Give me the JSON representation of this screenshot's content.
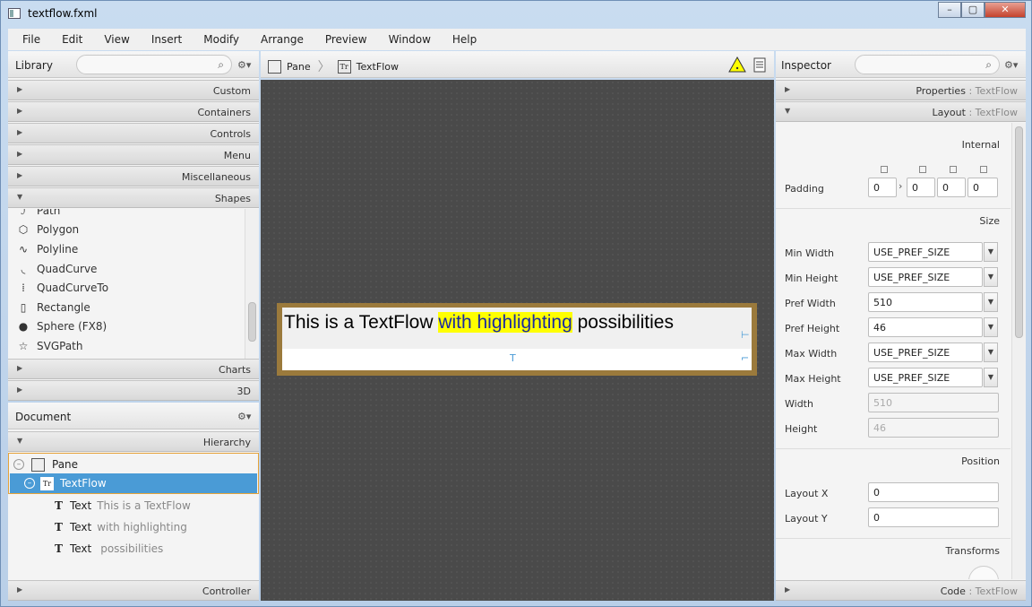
{
  "window": {
    "title": "textflow.fxml"
  },
  "menu": [
    "File",
    "Edit",
    "View",
    "Insert",
    "Modify",
    "Arrange",
    "Preview",
    "Window",
    "Help"
  ],
  "library": {
    "title": "Library",
    "sections_top": [
      "Custom",
      "Containers",
      "Controls",
      "Menu",
      "Miscellaneous",
      "Shapes"
    ],
    "items": [
      {
        "label": "Path",
        "icon": "path-icon"
      },
      {
        "label": "Polygon",
        "icon": "polygon-icon"
      },
      {
        "label": "Polyline",
        "icon": "polyline-icon"
      },
      {
        "label": "QuadCurve",
        "icon": "quadcurve-icon"
      },
      {
        "label": "QuadCurveTo",
        "icon": "quadcurveto-icon"
      },
      {
        "label": "Rectangle",
        "icon": "rectangle-icon"
      },
      {
        "label": "Sphere  (FX8)",
        "icon": "sphere-icon"
      },
      {
        "label": "SVGPath",
        "icon": "svgpath-icon"
      }
    ],
    "sections_bottom": [
      "Charts",
      "3D"
    ]
  },
  "document": {
    "title": "Document",
    "hierarchy_label": "Hierarchy",
    "tree": [
      {
        "type": "Pane",
        "text": ""
      },
      {
        "type": "TextFlow",
        "text": ""
      },
      {
        "type": "Text",
        "text": "This is a TextFlow"
      },
      {
        "type": "Text",
        "text": "with highlighting"
      },
      {
        "type": "Text",
        "text": "possibilities"
      }
    ],
    "controller_label": "Controller"
  },
  "breadcrumb": {
    "items": [
      "Pane",
      "TextFlow"
    ]
  },
  "textflow": {
    "part1": "This is a TextFlow ",
    "highlight": "with highlighting",
    "part3": " possibilities",
    "highlight_color": "#ffff00"
  },
  "inspector": {
    "title": "Inspector",
    "properties_label": "Properties",
    "layout_label": "Layout",
    "code_label": "Code",
    "selected": ": TextFlow",
    "internal_label": "Internal",
    "padding_label": "Padding",
    "padding": [
      "0",
      "0",
      "0",
      "0"
    ],
    "size_label": "Size",
    "rows": [
      {
        "label": "Min Width",
        "value": "USE_PREF_SIZE"
      },
      {
        "label": "Min Height",
        "value": "USE_PREF_SIZE"
      },
      {
        "label": "Pref Width",
        "value": "510"
      },
      {
        "label": "Pref Height",
        "value": "46"
      },
      {
        "label": "Max Width",
        "value": "USE_PREF_SIZE"
      },
      {
        "label": "Max Height",
        "value": "USE_PREF_SIZE"
      }
    ],
    "width_label": "Width",
    "width_value": "510",
    "height_label": "Height",
    "height_value": "46",
    "position_label": "Position",
    "layout_x_label": "Layout X",
    "layout_x": "0",
    "layout_y_label": "Layout Y",
    "layout_y": "0",
    "transforms_label": "Transforms"
  },
  "colors": {
    "accent": "#4a9bd6",
    "selection_border": "#e5a33a",
    "textflow_border": "#9b7a3c"
  }
}
